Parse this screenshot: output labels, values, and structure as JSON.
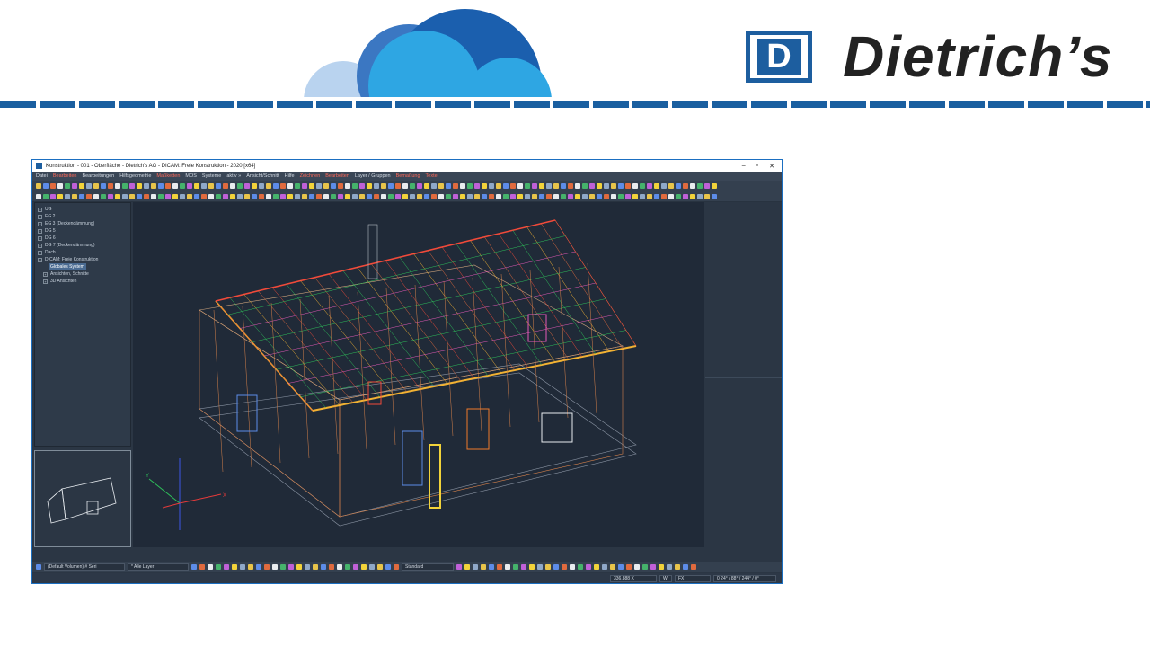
{
  "header": {
    "brand_name": "Dietrich’s",
    "logo_letter": "D",
    "colors": {
      "brand_blue": "#1d5e9f",
      "cloud_light": "#b9d3ef",
      "cloud_mid": "#2ea6e3",
      "cloud_dark": "#1b5fae"
    }
  },
  "window": {
    "title": "Konstruktion - 001 - Oberfläche - Dietrich’s AG - DICAM: Freie Konstruktion - 2020 [x64]",
    "controls": [
      "–",
      "▫",
      "✕"
    ]
  },
  "menu": [
    {
      "label": "Datei",
      "hl": false
    },
    {
      "label": "Bearbeiten",
      "hl": true
    },
    {
      "label": "Bearbeitungen",
      "hl": false
    },
    {
      "label": "Hilfsgeometrie",
      "hl": false
    },
    {
      "label": "Maßketten",
      "hl": true
    },
    {
      "label": "MOS",
      "hl": false
    },
    {
      "label": "Systeme",
      "hl": false
    },
    {
      "label": "aktiv »",
      "hl": false
    },
    {
      "label": "Ansicht/Schnitt",
      "hl": false
    },
    {
      "label": "Hilfe",
      "hl": false
    },
    {
      "label": "Zeichnen",
      "hl": true
    },
    {
      "label": "Bearbeiten",
      "hl": true
    },
    {
      "label": "Layer / Gruppen",
      "hl": false
    },
    {
      "label": "Bemaßung",
      "hl": true
    },
    {
      "label": "Texte",
      "hl": true
    }
  ],
  "tree": [
    {
      "label": "UG",
      "selected": false
    },
    {
      "label": "EG 2",
      "selected": false
    },
    {
      "label": "EG 3 (Deckendämmung)",
      "selected": false
    },
    {
      "label": "DG 5",
      "selected": false
    },
    {
      "label": "DG 6",
      "selected": false
    },
    {
      "label": "DG 7 (Deckendämmung)",
      "selected": false
    },
    {
      "label": "Dach",
      "selected": false
    },
    {
      "label": "DICAM: Freie Konstruktion",
      "selected": false
    },
    {
      "label": "Globales System",
      "selected": true
    },
    {
      "label": "Ansichten, Schnitte",
      "selected": false
    },
    {
      "label": "3D Ansichten",
      "selected": false
    }
  ],
  "axes": {
    "x_label": "X",
    "y_label": "Y"
  },
  "bottombar": {
    "volume_field": "(Default Volumen)  # Seri",
    "layer_field": "* Alle Layer",
    "standard_field": "Standard"
  },
  "statusbar": {
    "coords": "336.888 X",
    "w": "W",
    "fx": "FX",
    "angle": "0 24° / 88° / 244° / 0°"
  }
}
